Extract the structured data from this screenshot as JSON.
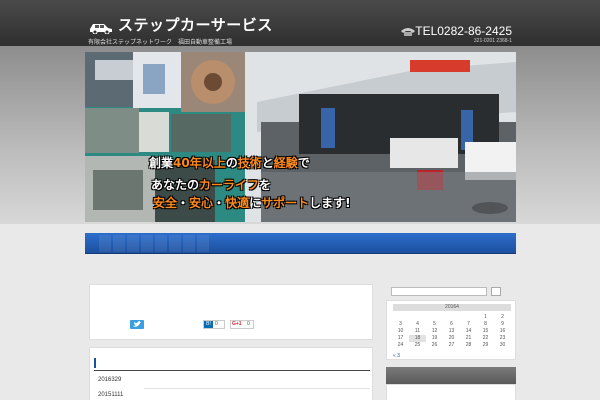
{
  "header": {
    "logo_title": "ステップカーサービス",
    "logo_sub": "有限会社ステップネットワーク　福田自動車整備工場",
    "tel": "TEL0282-86-2425",
    "address": "321-0201 2368-1"
  },
  "banner": {
    "catch_line1_a": "創業",
    "catch_line1_b": "40年以上",
    "catch_line1_c": "の",
    "catch_line1_d": "技術",
    "catch_line1_e": "と",
    "catch_line1_f": "経験",
    "catch_line1_g": "で",
    "catch_line2_a": "あなたの",
    "catch_line2_b": "カーライフ",
    "catch_line2_c": "を",
    "catch_line3_a": "安全",
    "catch_line3_b": "・",
    "catch_line3_c": "安心",
    "catch_line3_d": "・",
    "catch_line3_e": "快適",
    "catch_line3_f": "に",
    "catch_line3_g": "サポート",
    "catch_line3_h": "します!"
  },
  "post": {
    "tweet_label": "",
    "hatena_label": "B!",
    "hatena_count": "0",
    "gplus_label": "G+1",
    "gplus_count": "0"
  },
  "archive": {
    "items": [
      "2016329",
      "20151111"
    ]
  },
  "calendar": {
    "caption": "20164",
    "rows": [
      [
        "",
        "",
        "",
        "",
        "",
        "1",
        "2"
      ],
      [
        "3",
        "4",
        "5",
        "6",
        "7",
        "8",
        "9"
      ],
      [
        "10",
        "11",
        "12",
        "13",
        "14",
        "15",
        "16"
      ],
      [
        "17",
        "18",
        "19",
        "20",
        "21",
        "22",
        "23"
      ],
      [
        "24",
        "25",
        "26",
        "27",
        "28",
        "29",
        "30"
      ]
    ],
    "prev_link": "« 3"
  },
  "colors": {
    "header_bg": "#2f2f2f",
    "nav_blue": "#1d4f9e",
    "accent_orange": "#ff8a1c",
    "tweet_blue": "#3a9fe0"
  }
}
